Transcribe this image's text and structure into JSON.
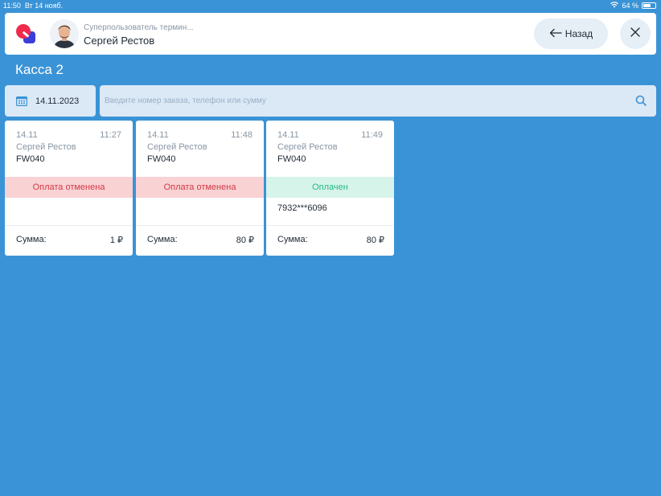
{
  "status_bar": {
    "time": "11:50",
    "date": "Вт 14 нояб.",
    "battery": "64 %",
    "battery_level": 0.64
  },
  "header": {
    "user_role": "Суперпользователь термин...",
    "user_name": "Сергей Рестов",
    "back_label": "Назад"
  },
  "page": {
    "title": "Касса 2"
  },
  "filter": {
    "date": "14.11.2023",
    "search_placeholder": "Введите номер заказа, телефон или сумму"
  },
  "orders": [
    {
      "date": "14.11",
      "time": "11:27",
      "name": "Сергей Рестов",
      "code": "FW040",
      "status": "Оплата отменена",
      "status_type": "cancelled",
      "phone": "",
      "sum_label": "Сумма:",
      "sum": "1 ₽"
    },
    {
      "date": "14.11",
      "time": "11:48",
      "name": "Сергей Рестов",
      "code": "FW040",
      "status": "Оплата отменена",
      "status_type": "cancelled",
      "phone": "",
      "sum_label": "Сумма:",
      "sum": "80 ₽"
    },
    {
      "date": "14.11",
      "time": "11:49",
      "name": "Сергей Рестов",
      "code": "FW040",
      "status": "Оплачен",
      "status_type": "paid",
      "phone": "7932***6096",
      "sum_label": "Сумма:",
      "sum": "80 ₽"
    }
  ],
  "colors": {
    "background": "#3a93d6",
    "cancelled_bg": "#f9d2d4",
    "cancelled_text": "#d23a45",
    "paid_bg": "#d6f4ea",
    "paid_text": "#26b989"
  }
}
